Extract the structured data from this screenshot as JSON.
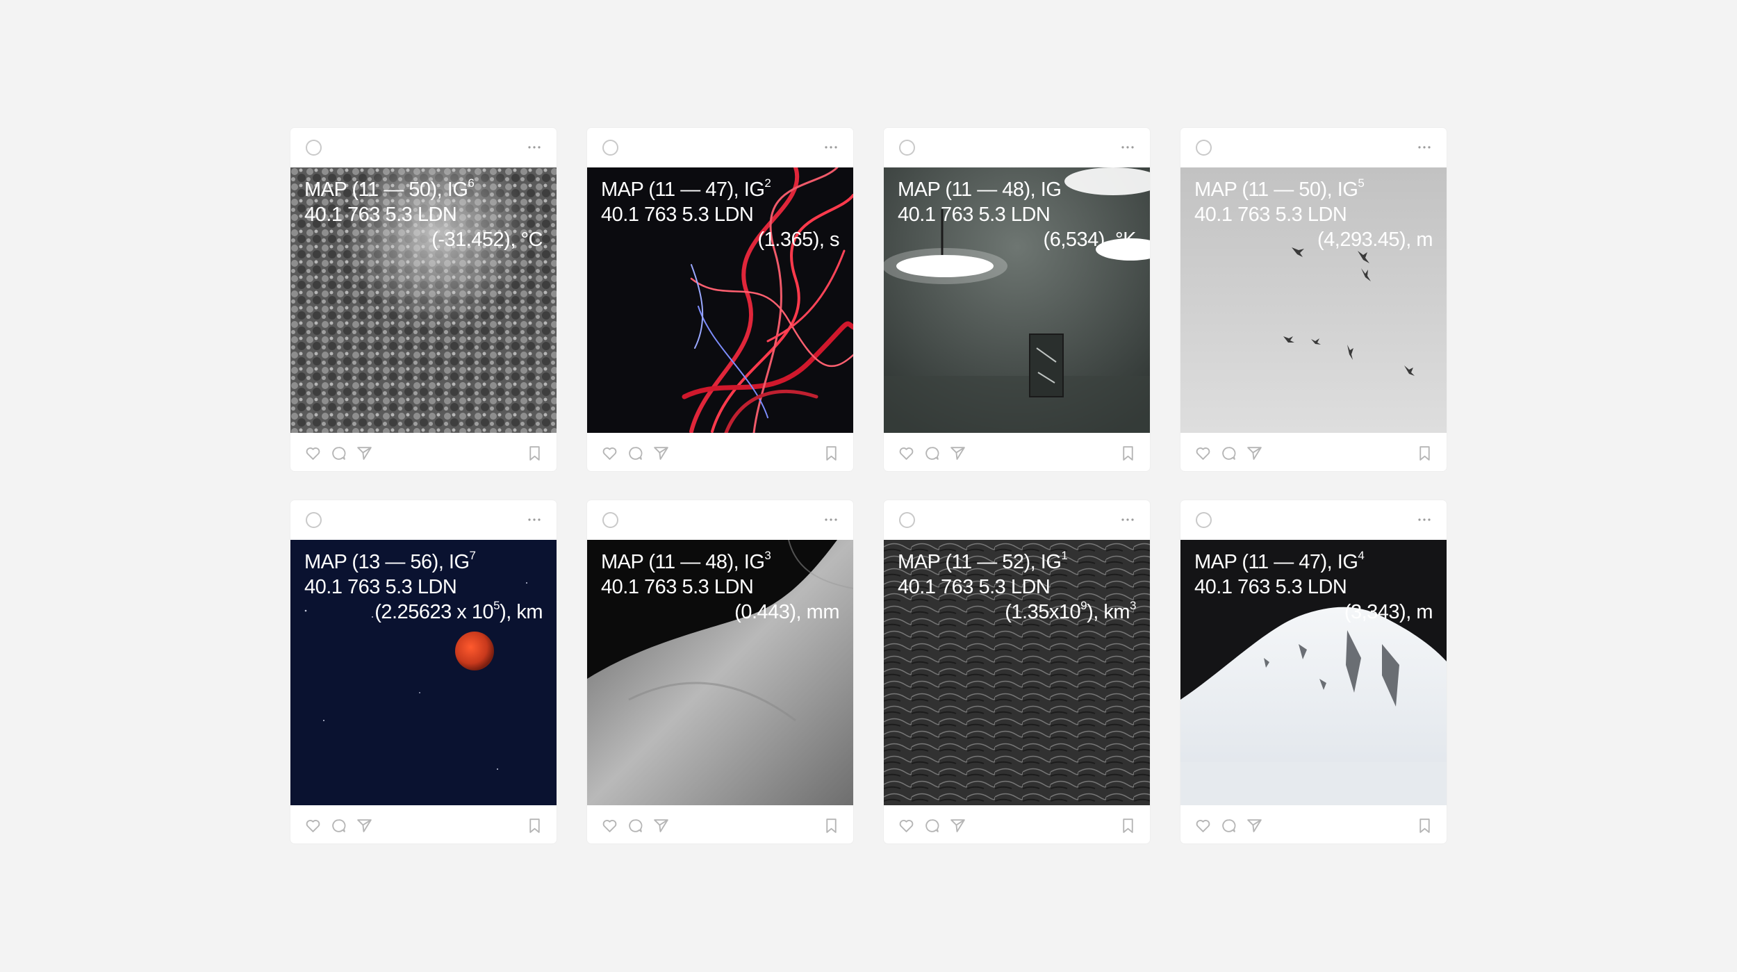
{
  "posts": [
    {
      "map": "MAP  (11 — 50),  IG",
      "sup": "6",
      "coords": "40.1  763 5.3  LDN",
      "measure": "(-31.452), °C"
    },
    {
      "map": "MAP  (11 — 47),  IG",
      "sup": "2",
      "coords": "40.1  763 5.3  LDN",
      "measure": "(1.365), s"
    },
    {
      "map": "MAP  (11 — 48),  IG",
      "sup": "",
      "coords": "40.1  763 5.3  LDN",
      "measure": "(6,534), °K"
    },
    {
      "map": "MAP  (11 — 50),  IG",
      "sup": "5",
      "coords": "40.1  763 5.3  LDN",
      "measure": "(4,293.45), m"
    },
    {
      "map": "MAP  (13 — 56),  IG",
      "sup": "7",
      "coords": "40.1  763 5.3  LDN",
      "measure_pre": "(2.25623 x 10",
      "measure_sup": "5",
      "measure_post": "), km"
    },
    {
      "map": "MAP  (11 — 48),  IG",
      "sup": "3",
      "coords": "40.1  763 5.3  LDN",
      "measure": "(0.443), mm"
    },
    {
      "map": "MAP  (11 — 52),  IG",
      "sup": "1",
      "coords": "40.1  763 5.3  LDN",
      "measure_pre": "(1.35x10",
      "measure_sup": "9",
      "measure_post": "), km",
      "measure_tail": "3"
    },
    {
      "map": "MAP  (11 — 47),  IG",
      "sup": "4",
      "coords": "40.1  763 5.3  LDN",
      "measure": "(3,343), m"
    }
  ],
  "icons": {
    "avatar": "avatar-icon",
    "more": "more-dots-icon",
    "like": "heart-icon",
    "comment": "comment-icon",
    "share": "send-icon",
    "save": "bookmark-icon"
  },
  "colors": {
    "background": "#f3f3f3",
    "card": "#ffffff",
    "icon": "#b5b5b5"
  }
}
